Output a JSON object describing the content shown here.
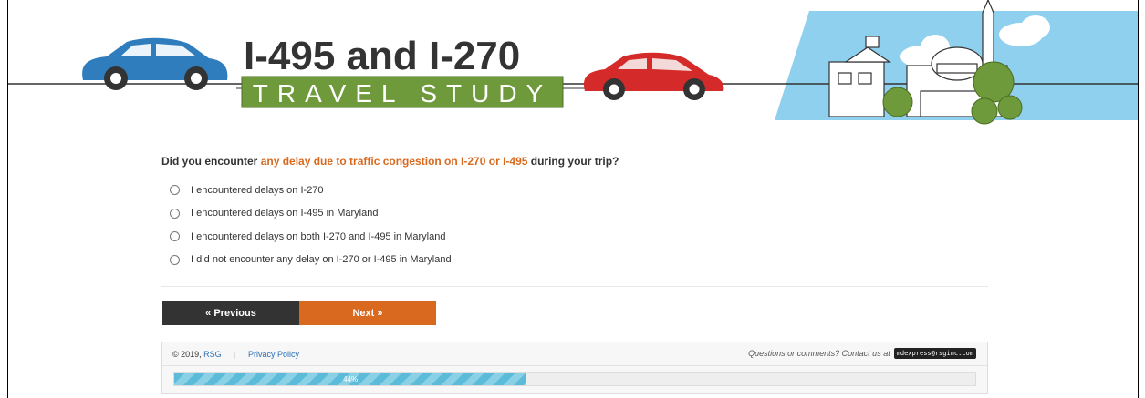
{
  "banner": {
    "title_line1": "I-495 and I-270",
    "title_line2": "TRAVEL STUDY"
  },
  "question": {
    "prefix": "Did you encounter ",
    "highlight": "any delay due to traffic congestion on I-270 or I-495",
    "suffix": " during your trip?",
    "options": [
      "I encountered delays on I-270",
      "I encountered delays on I-495 in Maryland",
      "I encountered delays on both I-270 and I-495 in Maryland",
      "I did not encounter any delay on I-270 or I-495 in Maryland"
    ]
  },
  "nav": {
    "previous_label": "« Previous",
    "next_label": "Next »"
  },
  "footer": {
    "copyright": "© 2019, ",
    "company": "RSG",
    "separator": "|",
    "privacy": "Privacy Policy",
    "contact_text": "Questions or comments? Contact us at",
    "email": "mdexpress@rsginc.com"
  },
  "progress": {
    "value": 0.44,
    "label": "44%"
  },
  "colors": {
    "accent_orange": "#d9691f",
    "dark_button": "#333333",
    "green_banner": "#6f9a3b",
    "sky_blue": "#8fd0ee",
    "car_blue": "#2f7dbd",
    "car_red": "#d52a2a",
    "progress_blue": "#5bbbd9"
  }
}
